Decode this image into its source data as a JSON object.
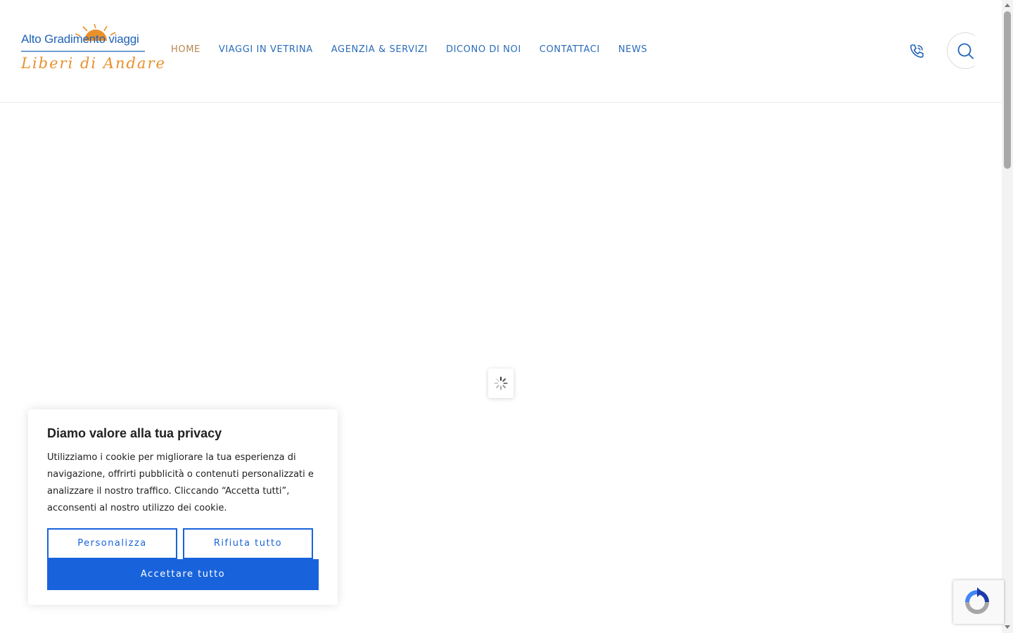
{
  "header": {
    "logo": {
      "line1": "Alto Gradimento viaggi",
      "line2": "Liberi di Andare",
      "primary_color": "#1f63b8",
      "accent_color": "#e9902b"
    },
    "nav": [
      {
        "label": "HOME",
        "active": true
      },
      {
        "label": "VIAGGI IN VETRINA",
        "active": false
      },
      {
        "label": "AGENZIA & SERVIZI",
        "active": false
      },
      {
        "label": "DICONO DI NOI",
        "active": false
      },
      {
        "label": "CONTATTACI",
        "active": false
      },
      {
        "label": "NEWS",
        "active": false
      }
    ],
    "nav_color": "#2a6cb8",
    "nav_active_color": "#b5874d",
    "icons": {
      "phone": "phone-icon",
      "search": "search-icon"
    }
  },
  "loader": {
    "icon": "spinner-icon"
  },
  "cookie_banner": {
    "title": "Diamo valore alla tua privacy",
    "text": "Utilizziamo i cookie per migliorare la tua esperienza di navigazione, offrirti pubblicità o contenuti personalizzati e analizzare il nostro traffico. Cliccando “Accetta tutti”, acconsenti al nostro utilizzo dei cookie.",
    "buttons": {
      "customize": "Personalizza",
      "reject": "Rifiuta tutto",
      "accept": "Accettare tutto"
    },
    "button_color": "#1863dc"
  },
  "recaptcha": {
    "icon": "recaptcha-icon"
  }
}
